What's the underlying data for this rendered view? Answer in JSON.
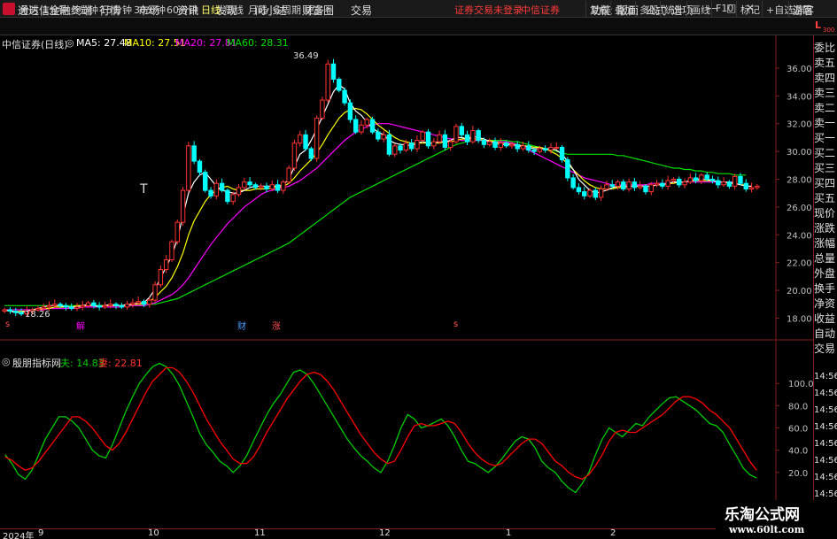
{
  "app": {
    "title": "通达信金融终端"
  },
  "menu": [
    "行情",
    "市场",
    "资讯",
    "发现",
    "问小达",
    "财富圈",
    "交易"
  ],
  "login_status": "证券交易未登录",
  "broker": "中信证券",
  "right_menu": [
    "功能",
    "版面",
    "公式",
    "选项"
  ],
  "guest": "游客",
  "period_tabs": [
    "分时",
    "1分钟",
    "5分钟",
    "15分钟",
    "30分钟",
    "60分钟",
    "日线",
    "周线",
    "月线",
    "多周期",
    "更多"
  ],
  "active_tab": "日线",
  "toolbar_buttons": [
    "复权",
    "叠加",
    "多股",
    "统计",
    "画线",
    "F10",
    "标记",
    "+自选",
    "返回"
  ],
  "corner_badge": {
    "letter": "L",
    "sub": "300"
  },
  "main_legend": {
    "stock": "中信证券(日线)",
    "ma5": "MA5: 27.48",
    "ma10": "MA10: 27.51",
    "ma20": "MA20: 27.81",
    "ma60": "MA60: 28.31"
  },
  "sub_legend": {
    "name": "殷朋指标网",
    "fu": "夫: 14.83",
    "qi": "妻: 22.81"
  },
  "annotations": {
    "high": "36.49",
    "low": "18.26",
    "t_marker": "T",
    "jie": "解",
    "cai": "财",
    "zhang": "涨",
    "s1": "s",
    "s2": "s"
  },
  "right_panel": [
    "委比",
    "卖五",
    "卖四",
    "卖三",
    "卖二",
    "卖一",
    "买一",
    "买二",
    "买三",
    "买四",
    "买五",
    "现价",
    "涨跌",
    "涨幅",
    "总量",
    "外盘",
    "换手",
    "净资",
    "收益",
    "自动",
    "交易"
  ],
  "right_times": [
    "14:56",
    "14:56",
    "14:56",
    "14:56",
    "14:56",
    "14:56",
    "14:56",
    "14:56",
    "14:56"
  ],
  "x_axis": [
    "2024年",
    "9",
    "10",
    "11",
    "12",
    "1",
    "2"
  ],
  "watermark": {
    "title": "乐淘公式网",
    "url": "www.60lt.com"
  },
  "colors": {
    "up": "#ff3232",
    "down": "#00ffff",
    "ma5": "#ffffff",
    "ma10": "#ffff00",
    "ma20": "#ff00ff",
    "ma60": "#00e000",
    "fu": "#00cc00",
    "qi": "#ff0000",
    "axis": "#802020"
  },
  "chart_data": [
    {
      "type": "candlestick",
      "title": "中信证券(日线)",
      "y_ticks": [
        18.0,
        20.0,
        22.0,
        24.0,
        26.0,
        28.0,
        30.0,
        32.0,
        34.0,
        36.0
      ],
      "ylim": [
        17.2,
        37.4
      ],
      "x_ticks": [
        "2024年",
        "9",
        "10",
        "11",
        "12",
        "1",
        "2"
      ],
      "high": 36.49,
      "low": 18.26,
      "ma": {
        "MA5": 27.48,
        "MA10": 27.51,
        "MA20": 27.81,
        "MA60": 28.31
      },
      "closes": [
        18.6,
        18.5,
        18.4,
        18.3,
        18.5,
        18.6,
        18.7,
        18.8,
        18.9,
        19.0,
        18.9,
        18.8,
        18.7,
        18.8,
        18.9,
        19.1,
        18.9,
        18.8,
        18.9,
        19.0,
        18.9,
        18.8,
        19.0,
        19.1,
        19.2,
        19.0,
        19.3,
        20.4,
        21.5,
        22.2,
        23.5,
        24.9,
        27.2,
        30.4,
        29.3,
        28.5,
        27.2,
        26.8,
        27.7,
        27.2,
        26.4,
        26.9,
        27.4,
        27.8,
        27.6,
        27.4,
        27.5,
        27.3,
        27.6,
        27.2,
        27.8,
        28.8,
        30.6,
        31.2,
        30.2,
        29.5,
        32.4,
        33.7,
        36.3,
        35.2,
        34.4,
        33.5,
        32.3,
        31.4,
        31.9,
        32.3,
        31.4,
        30.9,
        31.2,
        29.8,
        30.4,
        30.1,
        30.6,
        30.2,
        30.8,
        31.4,
        30.4,
        30.7,
        31.2,
        30.3,
        30.7,
        31.8,
        31.2,
        30.7,
        31.5,
        30.8,
        30.5,
        30.7,
        30.3,
        30.6,
        30.4,
        30.5,
        30.2,
        30.4,
        30.1,
        30.0,
        30.2,
        30.1,
        30.3,
        30.3,
        29.4,
        28.1,
        27.4,
        27.1,
        26.8,
        27.2,
        26.7,
        27.3,
        27.6,
        27.5,
        27.8,
        27.3,
        27.8,
        27.4,
        27.5,
        27.1,
        27.6,
        27.7,
        27.5,
        27.9,
        28.0,
        27.6,
        27.8,
        28.1,
        27.9,
        28.3,
        28.0,
        27.9,
        27.6,
        27.8,
        27.5,
        28.2,
        27.7,
        27.3,
        27.4,
        27.5
      ],
      "ma5_series": [
        18.6,
        18.5,
        18.4,
        18.4,
        18.5,
        18.6,
        18.7,
        18.8,
        18.9,
        18.9,
        18.9,
        18.8,
        18.8,
        18.8,
        18.9,
        19.0,
        18.9,
        18.8,
        18.9,
        19.0,
        18.9,
        18.9,
        19.0,
        19.0,
        19.1,
        19.1,
        19.5,
        20.1,
        20.9,
        21.7,
        22.5,
        23.7,
        25.4,
        27.0,
        27.8,
        28.3,
        28.5,
        28.0,
        27.5,
        27.2,
        27.1,
        27.0,
        27.0,
        27.2,
        27.4,
        27.5,
        27.5,
        27.5,
        27.5,
        27.5,
        27.6,
        28.0,
        28.9,
        29.8,
        30.1,
        30.8,
        31.6,
        32.5,
        33.4,
        34.3,
        34.8,
        34.5,
        33.5,
        32.9,
        32.6,
        32.1,
        31.7,
        31.4,
        31.2,
        30.8,
        30.6,
        30.5,
        30.5,
        30.4,
        30.6,
        30.7,
        30.6,
        30.6,
        30.7,
        30.7,
        30.8,
        31.0,
        31.0,
        30.9,
        31.1,
        31.0,
        30.9,
        30.7,
        30.6,
        30.5,
        30.5,
        30.5,
        30.4,
        30.4,
        30.3,
        30.2,
        30.2,
        30.2,
        30.2,
        30.1,
        29.8,
        29.3,
        28.7,
        28.0,
        27.6,
        27.2,
        27.0,
        27.1,
        27.2,
        27.4,
        27.5,
        27.5,
        27.5,
        27.5,
        27.5,
        27.5,
        27.5,
        27.6,
        27.6,
        27.7,
        27.8,
        27.8,
        27.8,
        27.9,
        28.0,
        28.0,
        28.0,
        27.9,
        27.8,
        27.8,
        27.8,
        27.7,
        27.6,
        27.5,
        27.5
      ],
      "ma10_series": [
        18.6,
        18.5,
        18.5,
        18.5,
        18.5,
        18.6,
        18.6,
        18.7,
        18.7,
        18.8,
        18.8,
        18.8,
        18.8,
        18.9,
        18.9,
        18.9,
        18.9,
        18.9,
        18.9,
        18.9,
        18.9,
        18.9,
        18.9,
        19.0,
        19.0,
        19.0,
        19.2,
        19.5,
        19.9,
        20.3,
        20.9,
        21.7,
        22.7,
        24.0,
        25.0,
        25.7,
        26.4,
        26.9,
        27.2,
        27.4,
        27.5,
        27.3,
        27.2,
        27.2,
        27.2,
        27.3,
        27.3,
        27.3,
        27.4,
        27.4,
        27.5,
        27.7,
        28.1,
        28.6,
        29.0,
        29.4,
        29.9,
        30.5,
        31.2,
        31.8,
        32.4,
        32.8,
        33.0,
        33.1,
        33.0,
        32.7,
        32.3,
        31.9,
        31.6,
        31.3,
        31.0,
        30.8,
        30.7,
        30.6,
        30.6,
        30.6,
        30.6,
        30.6,
        30.6,
        30.7,
        30.7,
        30.8,
        30.9,
        30.9,
        30.9,
        30.9,
        30.8,
        30.8,
        30.7,
        30.6,
        30.6,
        30.5,
        30.5,
        30.4,
        30.4,
        30.3,
        30.3,
        30.2,
        30.0,
        29.8,
        29.5,
        29.1,
        28.7,
        28.3,
        27.9,
        27.6,
        27.4,
        27.3,
        27.3,
        27.3,
        27.4,
        27.4,
        27.5,
        27.5,
        27.5,
        27.5,
        27.5,
        27.6,
        27.6,
        27.7,
        27.7,
        27.8,
        27.8,
        27.9,
        27.9,
        27.9,
        27.9,
        27.9,
        27.8,
        27.8,
        27.7,
        27.7,
        27.6,
        27.6
      ],
      "ma20_series": [
        18.6,
        18.6,
        18.6,
        18.6,
        18.6,
        18.6,
        18.6,
        18.6,
        18.7,
        18.7,
        18.7,
        18.7,
        18.7,
        18.7,
        18.8,
        18.8,
        18.8,
        18.8,
        18.8,
        18.8,
        18.8,
        18.8,
        18.9,
        18.9,
        18.9,
        18.9,
        19.0,
        19.1,
        19.3,
        19.5,
        19.7,
        20.0,
        20.4,
        20.9,
        21.5,
        22.1,
        22.7,
        23.3,
        23.8,
        24.3,
        24.8,
        25.2,
        25.6,
        26.0,
        26.3,
        26.6,
        26.9,
        27.1,
        27.2,
        27.3,
        27.4,
        27.5,
        27.7,
        27.9,
        28.2,
        28.5,
        28.8,
        29.2,
        29.6,
        30.0,
        30.4,
        30.8,
        31.1,
        31.4,
        31.6,
        31.8,
        31.9,
        32.0,
        32.0,
        32.0,
        31.9,
        31.8,
        31.7,
        31.6,
        31.5,
        31.4,
        31.3,
        31.2,
        31.1,
        31.0,
        30.9,
        30.9,
        30.8,
        30.8,
        30.8,
        30.8,
        30.8,
        30.7,
        30.7,
        30.7,
        30.7,
        30.6,
        30.5,
        30.3,
        30.1,
        29.9,
        29.7,
        29.5,
        29.3,
        29.1,
        28.9,
        28.7,
        28.5,
        28.3,
        28.1,
        28.0,
        27.9,
        27.8,
        27.7,
        27.6,
        27.6,
        27.6,
        27.6,
        27.6,
        27.6,
        27.6,
        27.7,
        27.7,
        27.7,
        27.7,
        27.8,
        27.8,
        27.8,
        27.8,
        27.8,
        27.8,
        27.8,
        27.8,
        27.8,
        27.8,
        27.8,
        27.8
      ],
      "ma60_series": [
        18.9,
        18.9,
        18.9,
        18.9,
        18.9,
        18.9,
        18.9,
        18.9,
        18.9,
        18.9,
        18.9,
        18.9,
        18.9,
        18.9,
        18.9,
        18.9,
        18.9,
        18.9,
        18.9,
        18.9,
        18.9,
        18.9,
        18.9,
        18.9,
        18.9,
        18.9,
        19.0,
        19.0,
        19.1,
        19.2,
        19.3,
        19.4,
        19.6,
        19.8,
        20.0,
        20.2,
        20.4,
        20.6,
        20.8,
        21.0,
        21.2,
        21.4,
        21.6,
        21.8,
        22.0,
        22.2,
        22.4,
        22.6,
        22.8,
        23.0,
        23.2,
        23.4,
        23.7,
        24.0,
        24.3,
        24.6,
        24.9,
        25.2,
        25.5,
        25.8,
        26.1,
        26.4,
        26.7,
        26.9,
        27.1,
        27.3,
        27.5,
        27.7,
        27.9,
        28.1,
        28.3,
        28.5,
        28.7,
        28.9,
        29.1,
        29.3,
        29.5,
        29.7,
        29.9,
        30.1,
        30.3,
        30.5,
        30.6,
        30.7,
        30.8,
        30.8,
        30.8,
        30.8,
        30.8,
        30.8,
        30.8,
        30.7,
        30.7,
        30.6,
        30.5,
        30.4,
        30.3,
        30.2,
        30.1,
        30.0,
        29.9,
        29.8,
        29.8,
        29.8,
        29.8,
        29.8,
        29.8,
        29.8,
        29.8,
        29.8,
        29.7,
        29.7,
        29.6,
        29.5,
        29.4,
        29.3,
        29.2,
        29.1,
        29.0,
        28.9,
        28.8,
        28.8,
        28.7,
        28.7,
        28.6,
        28.6,
        28.5,
        28.5,
        28.4,
        28.4,
        28.4,
        28.3,
        28.3,
        28.3
      ]
    },
    {
      "type": "line",
      "title": "殷朋指标网",
      "y_ticks": [
        20.0,
        40.0,
        60.0,
        80.0,
        100.0
      ],
      "ylim": [
        -4,
        120
      ],
      "series": [
        {
          "name": "夫",
          "values": [
            36,
            28,
            18,
            14,
            22,
            36,
            50,
            60,
            70,
            70,
            66,
            60,
            50,
            40,
            35,
            33,
            45,
            60,
            75,
            88,
            100,
            108,
            115,
            118,
            115,
            108,
            98,
            84,
            70,
            55,
            45,
            38,
            30,
            26,
            20,
            26,
            35,
            48,
            60,
            72,
            82,
            90,
            100,
            110,
            112,
            108,
            100,
            90,
            80,
            70,
            60,
            50,
            42,
            35,
            30,
            24,
            20,
            30,
            44,
            60,
            72,
            68,
            60,
            62,
            65,
            68,
            62,
            52,
            40,
            30,
            28,
            24,
            20,
            25,
            32,
            40,
            48,
            52,
            50,
            42,
            30,
            24,
            20,
            12,
            6,
            2,
            10,
            20,
            36,
            50,
            60,
            56,
            52,
            58,
            64,
            62,
            70,
            76,
            82,
            87,
            88,
            84,
            80,
            76,
            70,
            64,
            62,
            56,
            45,
            35,
            24,
            18,
            15
          ]
        },
        {
          "name": "妻",
          "values": [
            34,
            31,
            26,
            22,
            24,
            30,
            38,
            46,
            54,
            62,
            70,
            70,
            66,
            60,
            52,
            44,
            40,
            46,
            56,
            68,
            80,
            92,
            102,
            108,
            114,
            114,
            110,
            102,
            92,
            80,
            68,
            58,
            48,
            40,
            32,
            28,
            28,
            34,
            44,
            56,
            66,
            76,
            86,
            94,
            102,
            108,
            110,
            108,
            102,
            94,
            84,
            74,
            64,
            54,
            46,
            38,
            32,
            28,
            30,
            40,
            52,
            62,
            64,
            62,
            62,
            64,
            66,
            64,
            56,
            46,
            38,
            32,
            28,
            26,
            28,
            34,
            40,
            46,
            50,
            50,
            46,
            38,
            30,
            26,
            20,
            16,
            14,
            18,
            26,
            36,
            48,
            56,
            58,
            56,
            56,
            60,
            64,
            68,
            72,
            78,
            84,
            88,
            88,
            86,
            82,
            76,
            72,
            66,
            60,
            50,
            40,
            30,
            22
          ]
        }
      ]
    }
  ]
}
